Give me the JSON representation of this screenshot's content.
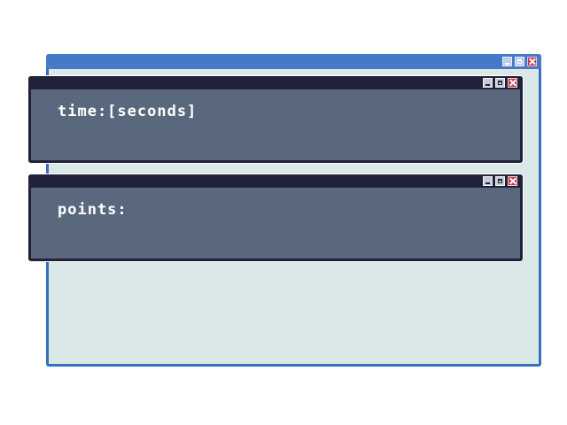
{
  "outer_window": {
    "controls": [
      "minimize-icon",
      "maximize-icon",
      "close-icon"
    ]
  },
  "timer_panel": {
    "label": "time:[seconds]",
    "controls": [
      "minimize-icon",
      "maximize-icon",
      "close-icon"
    ]
  },
  "points_panel": {
    "label": "points:",
    "controls": [
      "minimize-icon",
      "maximize-icon",
      "close-icon"
    ]
  },
  "colors": {
    "outer_frame": "#3a6fc0",
    "outer_body": "#dae8e8",
    "panel_frame": "#22213a",
    "panel_body": "#5a687e",
    "close_button": "#c83c4c",
    "text": "#ffffff"
  }
}
